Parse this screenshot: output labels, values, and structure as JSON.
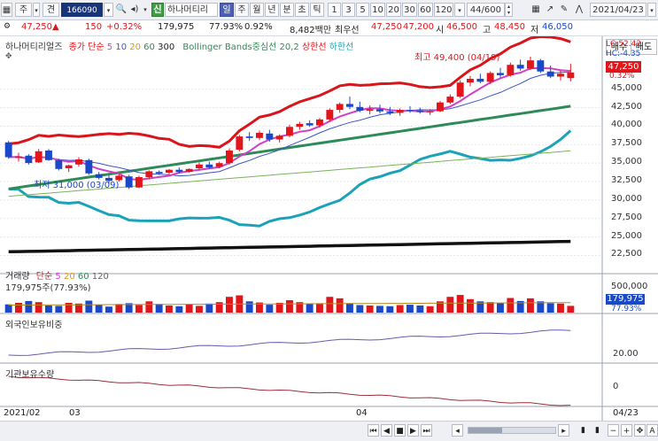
{
  "toolbar": {
    "buttons": [
      "주",
      "견"
    ],
    "code": "166090",
    "shin": "신",
    "name": "하나머티리",
    "periods": [
      "일",
      "주",
      "월",
      "년",
      "분",
      "초",
      "틱"
    ],
    "minutes": [
      "1",
      "3",
      "5",
      "10",
      "20",
      "30",
      "60",
      "120"
    ],
    "count": "44/600",
    "date": "2021/04/23"
  },
  "quote": {
    "price": "47,250",
    "arrow": "▲",
    "change": "150",
    "change_pct": "+0.32%",
    "volume": "179,975",
    "vol_ratio": "77.93%",
    "turnover_pct": "0.92%",
    "amount": "8,482백만",
    "pref_label": "최우선",
    "pref_ask": "47,250",
    "pref_bid": "47,200",
    "open_label": "시",
    "open": "46,500",
    "high_label": "고",
    "high": "48,450",
    "low_label": "저",
    "low": "46,050"
  },
  "chart_header": {
    "title": "하나머티리얼즈",
    "ma_label": "종가 단순",
    "ma_periods": [
      "5",
      "10",
      "20",
      "60",
      "300"
    ],
    "bb_label": "Bollinger Bands중심선 20,2",
    "upper": "상한선",
    "lower": "하한선",
    "buy": "매수",
    "sell": "매도",
    "lc": "LC:52.42",
    "hc": "HC:-4.35",
    "last": "47,250",
    "last_pct": "0.32%"
  },
  "annotations": {
    "high": "최고 49,400 (04/19)",
    "low": "최저 31,000 (03/09)"
  },
  "price_axis": [
    "45,000",
    "42,500",
    "40,000",
    "37,500",
    "35,000",
    "32,500",
    "30,000",
    "27,500",
    "25,000",
    "22,500"
  ],
  "volume_panel": {
    "title": "거래량",
    "ma_label": "단순",
    "ma_periods": [
      "5",
      "20",
      "60",
      "120"
    ],
    "current": "179,975주(77.93%)",
    "axis_top": "500,000",
    "last": "179,975",
    "last_pct": "77.93%"
  },
  "foreign_panel": {
    "title": "외국인보유비중",
    "axis": "20.00"
  },
  "inst_panel": {
    "title": "기관보유수량",
    "axis": "0"
  },
  "time_axis": {
    "start": "2021/02",
    "m3": "03",
    "m4": "04",
    "end": "04/23"
  },
  "colors": {
    "up": "#e0161b",
    "down": "#1948c9",
    "ma5": "#d23fc7",
    "ma20": "#2e8b57",
    "bb": "#d9141a",
    "lower": "#1aa3b8"
  },
  "chart_data": {
    "type": "candlestick",
    "dates": [
      "02/01",
      "02/02",
      "02/03",
      "02/04",
      "02/05",
      "02/08",
      "02/09",
      "02/10",
      "02/15",
      "02/16",
      "02/17",
      "02/18",
      "02/19",
      "02/22",
      "02/23",
      "02/24",
      "02/25",
      "02/26",
      "03/02",
      "03/03",
      "03/04",
      "03/05",
      "03/08",
      "03/09",
      "03/10",
      "03/11",
      "03/12",
      "03/15",
      "03/16",
      "03/17",
      "03/18",
      "03/19",
      "03/22",
      "03/23",
      "03/24",
      "03/25",
      "03/26",
      "03/29",
      "03/30",
      "03/31",
      "04/01",
      "04/02",
      "04/05",
      "04/06",
      "04/07",
      "04/08",
      "04/09",
      "04/12",
      "04/13",
      "04/14",
      "04/15",
      "04/16",
      "04/19",
      "04/20",
      "04/21",
      "04/22",
      "04/23"
    ],
    "ohlc": [
      [
        37800,
        38000,
        35600,
        35800
      ],
      [
        35700,
        36400,
        35200,
        35900
      ],
      [
        36000,
        36200,
        34800,
        35000
      ],
      [
        35100,
        36900,
        35000,
        36600
      ],
      [
        36700,
        36900,
        35300,
        35400
      ],
      [
        35400,
        35600,
        34000,
        34200
      ],
      [
        34300,
        34800,
        33800,
        34700
      ],
      [
        34800,
        35800,
        34500,
        35500
      ],
      [
        35400,
        35600,
        33400,
        33600
      ],
      [
        33500,
        33800,
        32800,
        33000
      ],
      [
        33000,
        33400,
        32200,
        32600
      ],
      [
        32700,
        33500,
        32500,
        33300
      ],
      [
        33200,
        33400,
        31500,
        31700
      ],
      [
        31700,
        33300,
        31600,
        33100
      ],
      [
        33100,
        34000,
        32800,
        33900
      ],
      [
        33800,
        34000,
        33400,
        33600
      ],
      [
        33700,
        34200,
        33500,
        34100
      ],
      [
        34100,
        34400,
        33600,
        33800
      ],
      [
        33800,
        34300,
        33700,
        34200
      ],
      [
        34300,
        35100,
        34000,
        34800
      ],
      [
        34800,
        35200,
        34200,
        34400
      ],
      [
        34500,
        35200,
        34300,
        35000
      ],
      [
        35000,
        37000,
        34800,
        36700
      ],
      [
        36800,
        38800,
        36600,
        38600
      ],
      [
        38600,
        39200,
        38000,
        38400
      ],
      [
        38400,
        39400,
        38100,
        39100
      ],
      [
        39000,
        39500,
        37900,
        38200
      ],
      [
        38200,
        38900,
        37800,
        38700
      ],
      [
        38700,
        40200,
        38500,
        39900
      ],
      [
        39900,
        40600,
        39500,
        40300
      ],
      [
        40400,
        40800,
        39900,
        40100
      ],
      [
        40100,
        41100,
        39800,
        40900
      ],
      [
        40900,
        42400,
        40600,
        42200
      ],
      [
        42200,
        43200,
        41800,
        43000
      ],
      [
        43000,
        44000,
        42300,
        42600
      ],
      [
        42600,
        43300,
        41900,
        42100
      ],
      [
        42100,
        42800,
        41600,
        42300
      ],
      [
        42300,
        42900,
        41700,
        42000
      ],
      [
        42000,
        42600,
        41500,
        41800
      ],
      [
        41800,
        42400,
        41400,
        42200
      ],
      [
        42200,
        42700,
        41800,
        42100
      ],
      [
        42100,
        42500,
        41700,
        41900
      ],
      [
        41900,
        42300,
        41500,
        42000
      ],
      [
        42000,
        43400,
        41900,
        43200
      ],
      [
        43200,
        44300,
        43000,
        44000
      ],
      [
        44000,
        46200,
        43800,
        45900
      ],
      [
        45900,
        46800,
        45400,
        46400
      ],
      [
        46400,
        47100,
        45800,
        46000
      ],
      [
        46000,
        47400,
        45700,
        47200
      ],
      [
        47200,
        47900,
        46600,
        46900
      ],
      [
        46900,
        48600,
        46700,
        48300
      ],
      [
        48300,
        49000,
        47500,
        47800
      ],
      [
        47800,
        49400,
        47600,
        48900
      ],
      [
        48900,
        49100,
        47200,
        47400
      ],
      [
        47400,
        48200,
        46500,
        46700
      ],
      [
        46700,
        47500,
        46200,
        47100
      ],
      [
        46500,
        48450,
        46050,
        47250
      ]
    ],
    "y_range": [
      21000,
      50000
    ],
    "volume": [
      220000,
      260000,
      310000,
      280000,
      190000,
      180000,
      260000,
      240000,
      320000,
      210000,
      160000,
      230000,
      250000,
      200000,
      300000,
      230000,
      190000,
      170000,
      220000,
      180000,
      240000,
      280000,
      420000,
      460000,
      300000,
      270000,
      210000,
      260000,
      330000,
      280000,
      230000,
      250000,
      420000,
      380000,
      250000,
      200000,
      190000,
      180000,
      170000,
      200000,
      210000,
      190000,
      170000,
      300000,
      420000,
      470000,
      360000,
      300000,
      280000,
      260000,
      390000,
      310000,
      380000,
      300000,
      250000,
      240000,
      179975
    ],
    "volume_max": 520000
  }
}
